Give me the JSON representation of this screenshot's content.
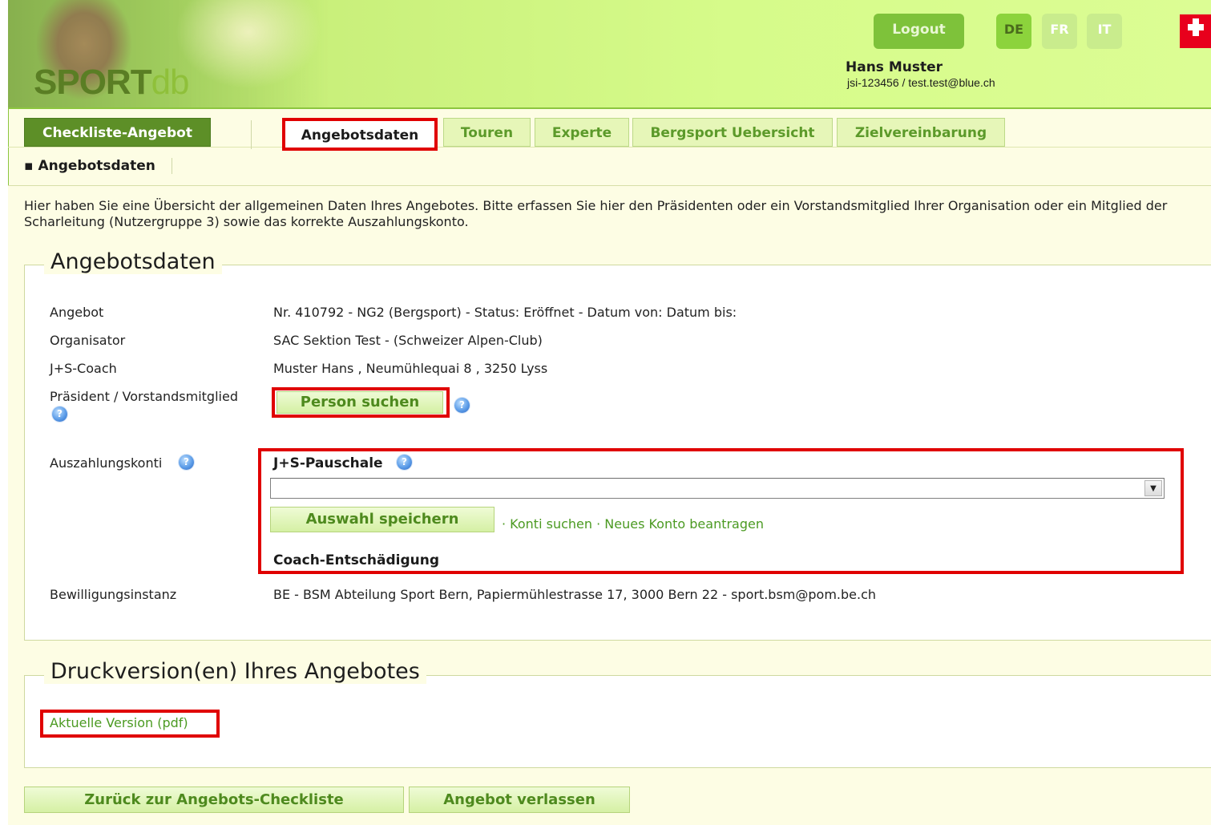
{
  "header": {
    "logo_main": "SPORT",
    "logo_suffix": "db",
    "logout_label": "Logout",
    "languages": [
      "DE",
      "FR",
      "IT"
    ],
    "user_name": "Hans Muster",
    "user_info": "jsi-123456 / test.test@blue.ch"
  },
  "tabs": {
    "checkliste": "Checkliste-Angebot",
    "items": [
      "Angebotsdaten",
      "Touren",
      "Experte",
      "Bergsport Uebersicht",
      "Zielvereinbarung"
    ],
    "active": "Angebotsdaten"
  },
  "breadcrumb": "▪ Angebotsdaten",
  "intro": "Hier haben Sie eine Übersicht der allgemeinen Daten Ihres Angebotes. Bitte erfassen Sie hier den Präsidenten oder ein Vorstandsmitglied Ihrer Organisation oder ein Mitglied der Scharleitung (Nutzergruppe 3) sowie das korrekte Auszahlungskonto.",
  "angebotsdaten": {
    "title": "Angebotsdaten",
    "rows": [
      {
        "label": "Angebot",
        "value": "Nr. 410792 - NG2 (Bergsport) - Status: Eröffnet - Datum von: Datum bis:"
      },
      {
        "label": "Organisator",
        "value": "SAC Sektion Test - (Schweizer Alpen-Club)"
      },
      {
        "label": "J+S-Coach",
        "value": "Muster Hans , Neumühlequai 8 , 3250 Lyss"
      }
    ],
    "praesident_label": "Präsident / Vorstandsmitglied",
    "person_button": "Person suchen",
    "auszahlung_label": "Auszahlungskonti",
    "pauschale_label": "J+S-Pauschale",
    "select_value": "",
    "save_button": "Auswahl speichern",
    "link_konti": "Konti suchen",
    "link_neu": "Neues Konto beantragen",
    "coach_label": "Coach-Entschädigung",
    "bewilligung_label": "Bewilligungsinstanz",
    "bewilligung_value": "BE - BSM Abteilung Sport Bern, Papiermühlestrasse 17, 3000 Bern 22 - sport.bsm@pom.be.ch"
  },
  "druck": {
    "title": "Druckversion(en) Ihres Angebotes",
    "pdf_link": "Aktuelle Version (pdf)"
  },
  "footer": {
    "back_button": "Zurück zur Angebots-Checkliste",
    "leave_button": "Angebot verlassen"
  },
  "colors": {
    "accent_green": "#5d8f27",
    "highlight_red": "#e00000",
    "link_green": "#4b9a22"
  }
}
